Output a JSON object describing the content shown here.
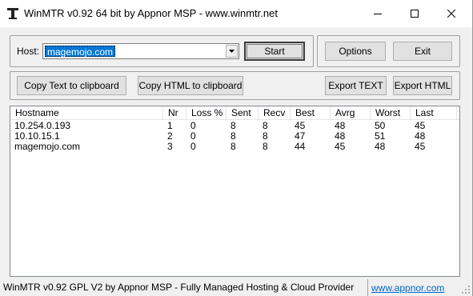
{
  "window": {
    "title": "WinMTR v0.92 64 bit by Appnor MSP - www.winmtr.net",
    "icons": {
      "app": "winmtr-app-icon",
      "minimize": "minimize-icon",
      "maximize": "maximize-icon",
      "close": "close-icon"
    }
  },
  "host": {
    "label": "Host:",
    "value": "magemojo.com",
    "dropdown_icon": "chevron-down-icon"
  },
  "buttons": {
    "start": "Start",
    "options": "Options",
    "exit": "Exit",
    "copy_text": "Copy Text to clipboard",
    "copy_html": "Copy HTML to clipboard",
    "export_text": "Export TEXT",
    "export_html": "Export HTML"
  },
  "table": {
    "columns": [
      "Hostname",
      "Nr",
      "Loss %",
      "Sent",
      "Recv",
      "Best",
      "Avrg",
      "Worst",
      "Last"
    ],
    "rows": [
      [
        "10.254.0.193",
        "1",
        "0",
        "8",
        "8",
        "45",
        "48",
        "50",
        "45"
      ],
      [
        "10.10.15.1",
        "2",
        "0",
        "8",
        "8",
        "47",
        "48",
        "51",
        "48"
      ],
      [
        "magemojo.com",
        "3",
        "0",
        "8",
        "8",
        "44",
        "45",
        "48",
        "45"
      ]
    ]
  },
  "status": {
    "text": "WinMTR v0.92 GPL V2 by Appnor MSP - Fully Managed Hosting & Cloud Provider",
    "link": "www.appnor.com"
  },
  "colors": {
    "selection": "#0078d7",
    "link": "#0066cc",
    "window_bg": "#f0f0f0"
  }
}
